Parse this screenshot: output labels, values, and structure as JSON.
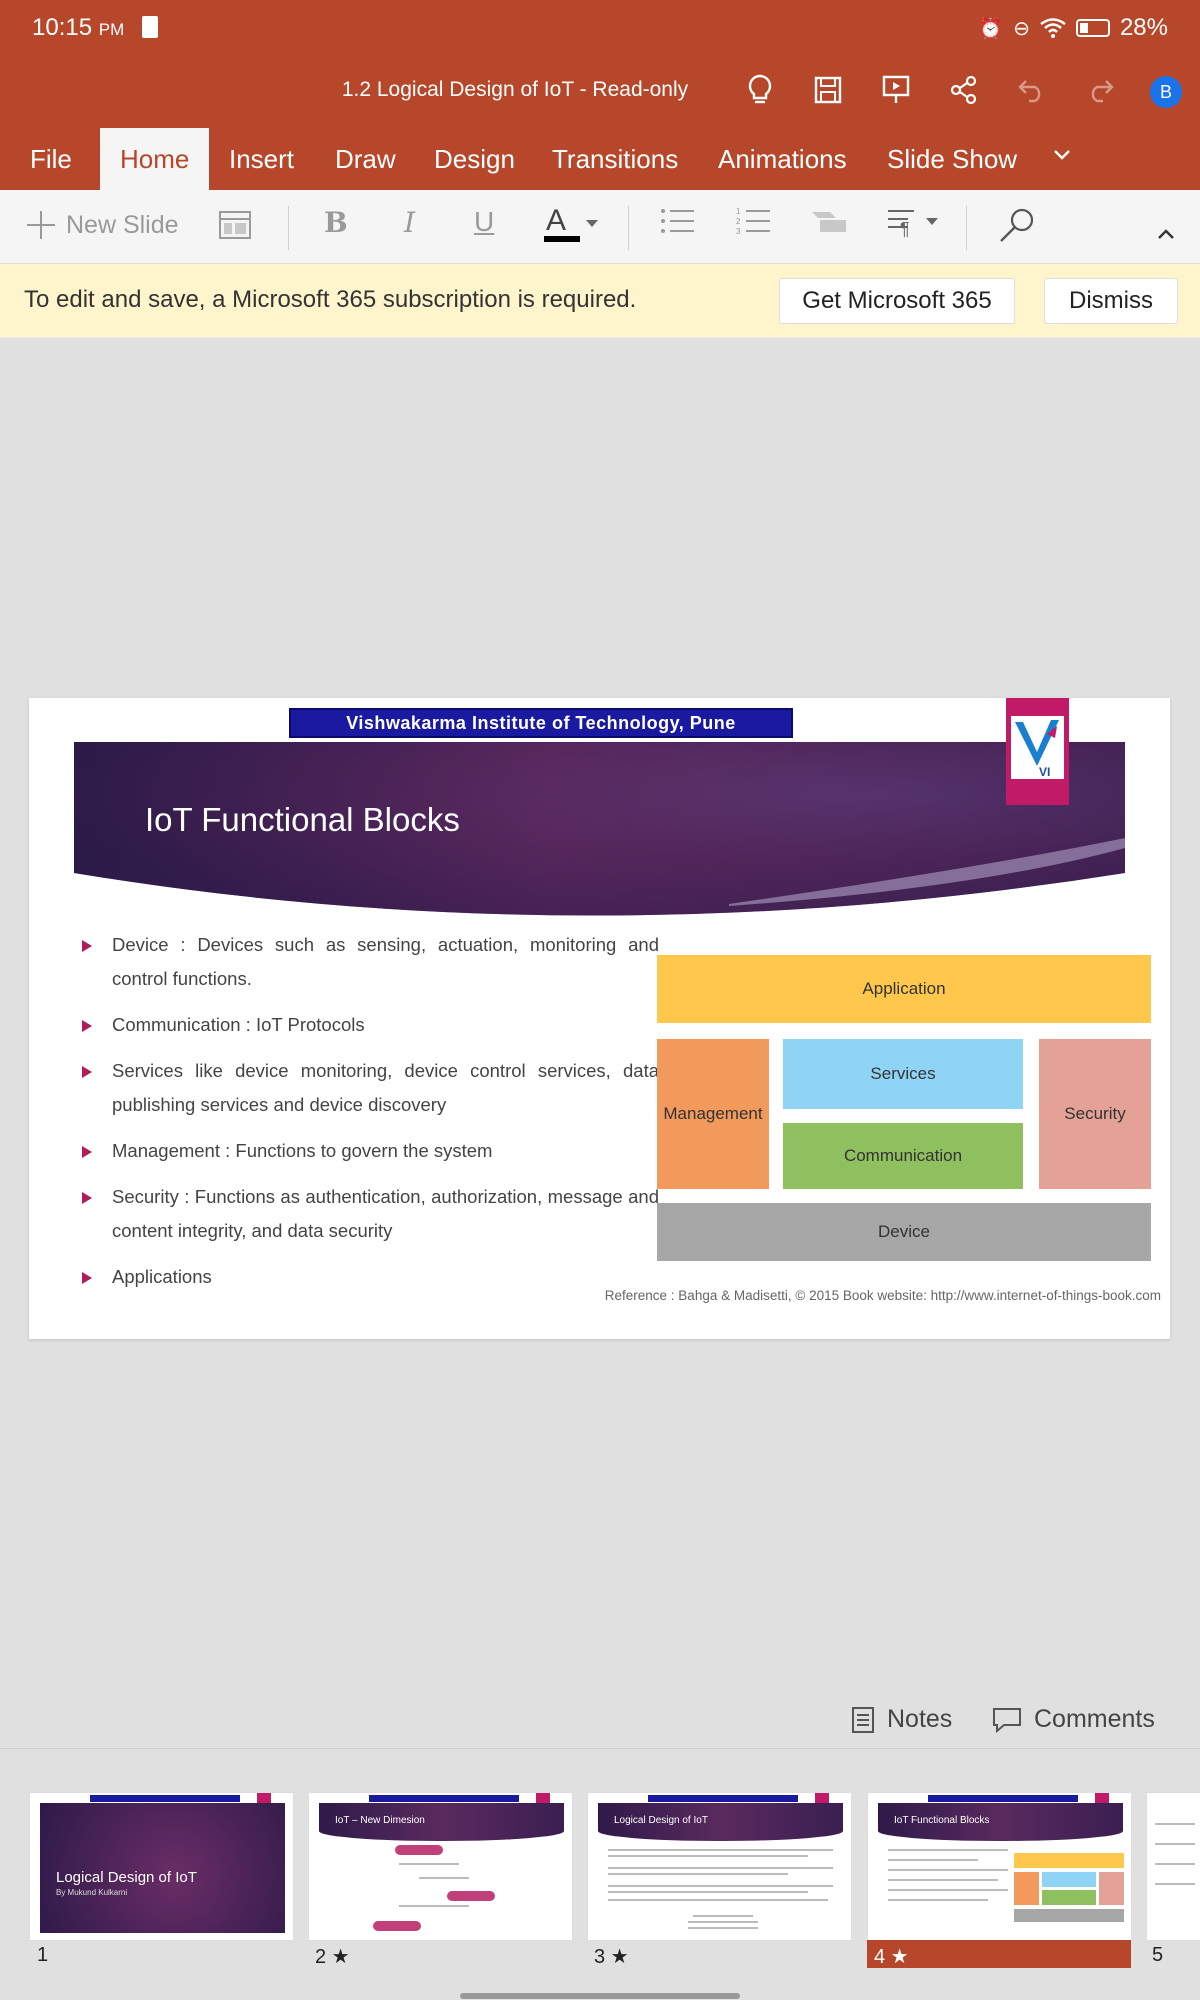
{
  "status": {
    "time": "10:15",
    "ampm": "PM",
    "battery": "28%"
  },
  "titlebar": {
    "title": "1.2 Logical Design of IoT - Read-only",
    "avatar_initial": "B"
  },
  "tabs": [
    {
      "label": "File"
    },
    {
      "label": "Home",
      "active": true
    },
    {
      "label": "Insert"
    },
    {
      "label": "Draw"
    },
    {
      "label": "Design"
    },
    {
      "label": "Transitions"
    },
    {
      "label": "Animations"
    },
    {
      "label": "Slide Show"
    }
  ],
  "toolbar": {
    "new_slide": "New Slide"
  },
  "notice": {
    "text": "To edit and save, a Microsoft 365 subscription is required.",
    "get_button": "Get Microsoft 365",
    "dismiss_button": "Dismiss"
  },
  "slide": {
    "institute": "Vishwakarma  Institute  of  Technology, Pune",
    "logo_text": "VI",
    "title": "IoT Functional Blocks",
    "bullets": [
      "Device : Devices such as sensing, actuation, monitoring and control functions.",
      "Communication : IoT Protocols",
      "Services like device monitoring, device control services, data publishing services and device discovery",
      "Management : Functions to govern the system",
      "Security : Functions as authentication, authorization, message and content integrity, and data security",
      "Applications"
    ],
    "diagram": {
      "application": "Application",
      "management": "Management",
      "services": "Services",
      "communication": "Communication",
      "security": "Security",
      "device": "Device"
    },
    "reference": "Reference : Bahga & Madisetti, © 2015 Book website: http://www.internet-of-things-book.com"
  },
  "bottom": {
    "notes": "Notes",
    "comments": "Comments"
  },
  "thumbnails": [
    {
      "number": "1",
      "title": "Logical Design of IoT",
      "subtitle": "By Mukund Kulkarni"
    },
    {
      "number": "2 ★",
      "title": "IoT – New Dimesion"
    },
    {
      "number": "3 ★",
      "title": "Logical Design of IoT"
    },
    {
      "number": "4 ★",
      "title": "IoT Functional Blocks",
      "selected": true
    },
    {
      "number": "5"
    }
  ],
  "colors": {
    "accent": "#b7472a",
    "application_block": "#ffc84d",
    "management_block": "#f29a5c",
    "services_block": "#8fd3f5",
    "communication_block": "#8fc060",
    "security_block": "#e4a296",
    "device_block": "#a6a6a6"
  }
}
